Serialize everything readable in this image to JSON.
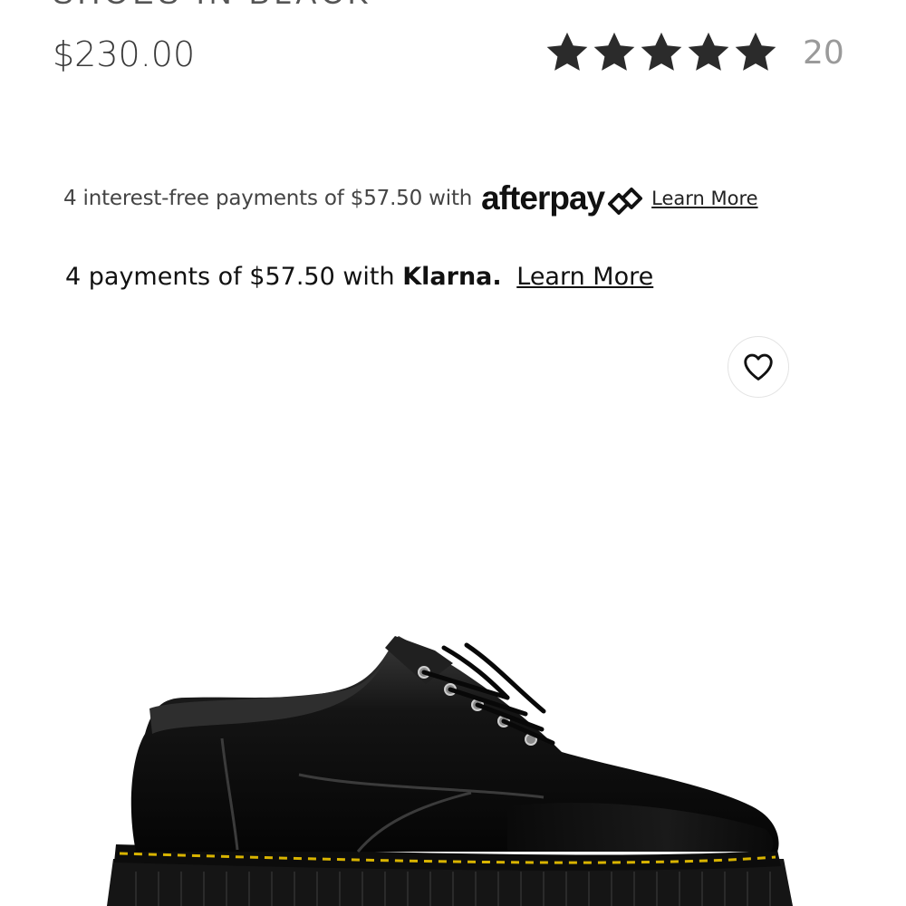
{
  "product": {
    "title": "SHOES IN BLACK",
    "price": "$230.00",
    "rating": {
      "stars": 5,
      "max_stars": 5,
      "review_count": "20"
    }
  },
  "payments": {
    "afterpay": {
      "text": "4 interest-free payments of $57.50 with",
      "brand": "afterpay",
      "learn_more": "Learn More"
    },
    "klarna": {
      "text": "4 payments of $57.50 with",
      "brand": "Klarna.",
      "learn_more": "Learn More"
    }
  },
  "icons": {
    "wishlist": "heart-icon",
    "star": "star-icon",
    "afterpay_mark": "afterpay-arrows-icon"
  },
  "colors": {
    "star": "#2b2b2b",
    "review_count": "#9a9a9a",
    "price": "#3a3a3a",
    "stitching": "#d9b400"
  }
}
